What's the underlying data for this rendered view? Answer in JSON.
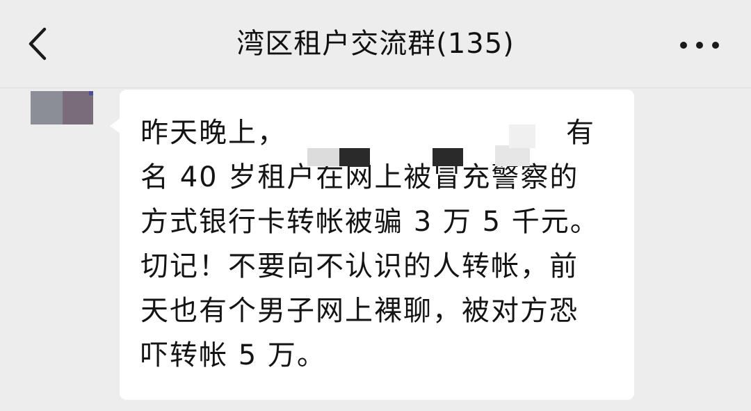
{
  "nav": {
    "title": "湾区租户交流群(135)",
    "back_icon": "chevron-left-icon",
    "more_icon": "more-horizontal-icon"
  },
  "message": {
    "lines": [
      "昨天晚上，",
      "名 40 岁租户在网上被冒充警察的",
      "方式银行卡转帐被骗 3 万 5 千元。",
      "切记！不要向不认识的人转帐，前",
      "天也有个男子网上裸聊，被对方恐",
      "吓转帐 5 万。"
    ],
    "line1_tail": "有"
  },
  "colors": {
    "background": "#ededed",
    "bubble": "#ffffff",
    "text": "#141414"
  }
}
